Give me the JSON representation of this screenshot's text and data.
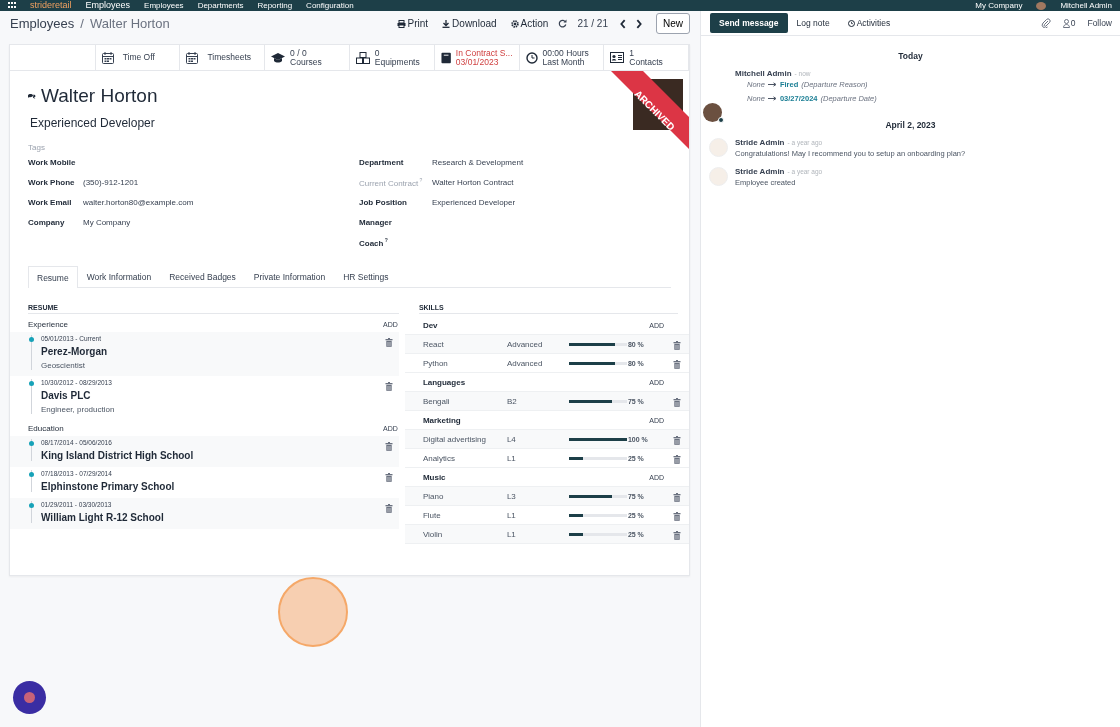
{
  "navbar": {
    "brand": "strideretail",
    "app": "Employees",
    "menu": [
      "Employees",
      "Departments",
      "Reporting",
      "Configuration"
    ],
    "company": "My Company",
    "user": "Mitchell Admin"
  },
  "control_panel": {
    "breadcrumb": [
      "Employees",
      "Walter Horton"
    ],
    "separator": "/",
    "actions": [
      {
        "kind": "print",
        "label": "Print"
      },
      {
        "kind": "download",
        "label": "Download"
      },
      {
        "kind": "gear",
        "label": "Action"
      }
    ],
    "pager": "21 / 21",
    "new_button": "New"
  },
  "smart_buttons": [
    {
      "kind": "calendar",
      "line1": "Time Off",
      "alert": false
    },
    {
      "kind": "calendar",
      "line1": "Timesheets",
      "alert": false
    },
    {
      "kind": "cap",
      "line1": "0 / 0",
      "line2": "Courses",
      "alert": false
    },
    {
      "kind": "cubes",
      "line1": "0",
      "line2": "Equipments",
      "alert": false
    },
    {
      "kind": "book",
      "line1": "In Contract S...",
      "line2": "03/01/2023",
      "alert": true
    },
    {
      "kind": "clock",
      "line1": "00:00 Hours",
      "line2": "Last Month",
      "alert": false
    },
    {
      "kind": "card",
      "line1": "1",
      "line2": "Contacts",
      "alert": false
    }
  ],
  "employee": {
    "name": "Walter Horton",
    "job_title": "Experienced Developer",
    "ribbon": "ARCHIVED",
    "tags_label": "Tags"
  },
  "left_fields": [
    {
      "label": "Work Mobile",
      "bold": true,
      "help": false
    },
    {
      "label": "Work Phone",
      "value": "(350)-912-1201",
      "bold": true,
      "help": false
    },
    {
      "label": "Work Email",
      "value": "walter.horton80@example.com",
      "bold": true,
      "help": false
    },
    {
      "label": "Company",
      "value": "My Company",
      "bold": true,
      "help": false
    }
  ],
  "right_fields": [
    {
      "label": "Department",
      "value": "Research & Development",
      "bold": true,
      "help": false
    },
    {
      "label": "Current Contract",
      "value": "Walter Horton Contract",
      "bold": false,
      "help": true
    },
    {
      "label": "Job Position",
      "value": "Experienced Developer",
      "bold": true,
      "help": false
    },
    {
      "label": "Manager",
      "bold": true,
      "help": false
    },
    {
      "label": "Coach",
      "bold": true,
      "help": true
    }
  ],
  "help_mark": "?",
  "tabs": [
    {
      "label": "Resume",
      "selected": true
    },
    {
      "label": "Work Information",
      "selected": false
    },
    {
      "label": "Received Badges",
      "selected": false
    },
    {
      "label": "Private Information",
      "selected": false
    },
    {
      "label": "HR Settings",
      "selected": false
    }
  ],
  "resume": {
    "title": "RESUME",
    "sections": [
      {
        "title": "Experience",
        "add": "ADD",
        "lines": [
          {
            "dates": "05/01/2013 - Current",
            "name": "Perez-Morgan",
            "description": "Geoscientist"
          },
          {
            "dates": "10/30/2012 - 08/29/2013",
            "name": "Davis PLC",
            "description": "Engineer, production"
          }
        ]
      },
      {
        "title": "Education",
        "add": "ADD",
        "lines": [
          {
            "dates": "08/17/2014 - 05/06/2016",
            "name": "King Island District High School"
          },
          {
            "dates": "07/18/2013 - 07/29/2014",
            "name": "Elphinstone Primary School"
          },
          {
            "dates": "01/29/2011 - 03/30/2013",
            "name": "William Light R-12 School"
          }
        ]
      }
    ]
  },
  "skills": {
    "title": "SKILLS",
    "groups": [
      {
        "title": "Dev",
        "add": "ADD",
        "skills": [
          {
            "name": "React",
            "level_name": "Advanced",
            "level": 0.8,
            "reading": "80 %"
          },
          {
            "name": "Python",
            "level_name": "Advanced",
            "level": 0.8,
            "reading": "80 %"
          }
        ]
      },
      {
        "title": "Languages",
        "add": "ADD",
        "skills": [
          {
            "name": "Bengali",
            "level_name": "B2",
            "level": 0.75,
            "reading": "75 %"
          }
        ]
      },
      {
        "title": "Marketing",
        "add": "ADD",
        "skills": [
          {
            "name": "Digital advertising",
            "level_name": "L4",
            "level": 1,
            "reading": "100 %"
          },
          {
            "name": "Analytics",
            "level_name": "L1",
            "level": 0.25,
            "reading": "25 %"
          }
        ]
      },
      {
        "title": "Music",
        "add": "ADD",
        "skills": [
          {
            "name": "Piano",
            "level_name": "L3",
            "level": 0.75,
            "reading": "75 %"
          },
          {
            "name": "Flute",
            "level_name": "L1",
            "level": 0.25,
            "reading": "25 %"
          },
          {
            "name": "Violin",
            "level_name": "L1",
            "level": 0.25,
            "reading": "25 %"
          }
        ]
      }
    ]
  },
  "chatter": {
    "buttons": [
      {
        "label": "Send message",
        "selected": true
      },
      {
        "label": "Log note",
        "selected": false
      },
      {
        "label": "Activities",
        "selected": false
      }
    ],
    "followers": "0",
    "follow": "Follow",
    "days": [
      {
        "date": "Today",
        "messages": [
          {
            "author": "Mitchell Admin",
            "kind": "photo",
            "time": "- now",
            "changes": [
              {
                "old": "None",
                "new": "Fired",
                "field": "(Departure Reason)"
              },
              {
                "old": "None",
                "new": "03/27/2024",
                "field": "(Departure Date)"
              }
            ]
          }
        ]
      },
      {
        "date": "April 2, 2023",
        "messages": [
          {
            "author": "Stride Admin",
            "kind": "logo",
            "time": "- a year ago",
            "body": "Congratulations! May I recommend you to setup an onboarding plan?"
          },
          {
            "author": "Stride Admin",
            "kind": "logo",
            "time": "- a year ago",
            "body": "Employee created"
          }
        ]
      }
    ]
  }
}
